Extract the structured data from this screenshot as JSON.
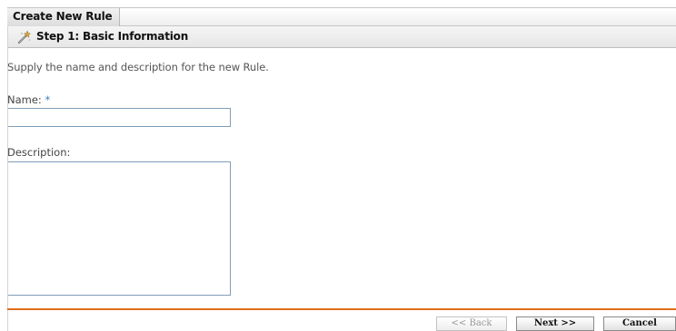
{
  "window": {
    "title": "Create New Rule"
  },
  "step": {
    "icon": "wand-icon",
    "title": "Step 1: Basic Information"
  },
  "form": {
    "instructions": "Supply the name and description for the new Rule.",
    "name_label": "Name:",
    "name_required_marker": "*",
    "name_value": "",
    "description_label": "Description:",
    "description_value": ""
  },
  "buttons": {
    "back_label": "<< Back",
    "next_label": "Next >>",
    "cancel_label": "Cancel"
  },
  "colors": {
    "divider": "#e06c1c",
    "required_marker": "#3b7dc4",
    "input_border": "#7f9db9"
  }
}
